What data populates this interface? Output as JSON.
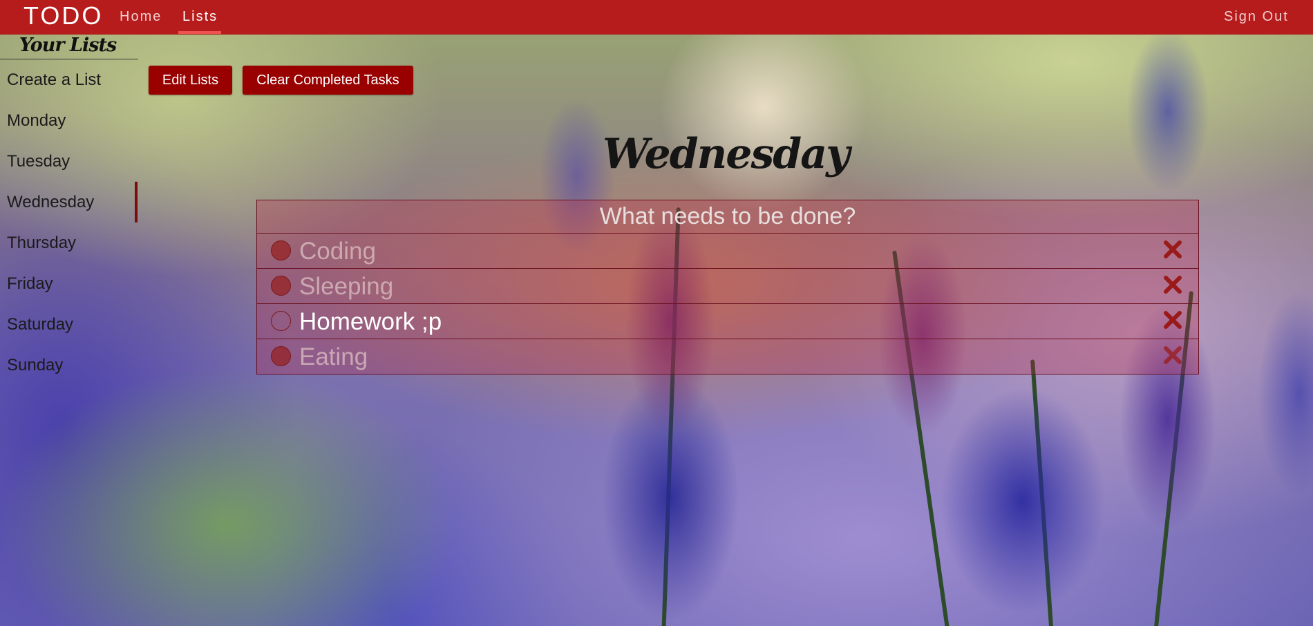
{
  "navbar": {
    "brand": "TODO",
    "links": [
      {
        "label": "Home"
      },
      {
        "label": "Lists"
      }
    ],
    "sign_out": "Sign Out",
    "color": "#b71c1c"
  },
  "sidebar": {
    "title": "Your Lists",
    "create_label": "Create a List",
    "items": [
      {
        "label": "Monday"
      },
      {
        "label": "Tuesday"
      },
      {
        "label": "Wednesday"
      },
      {
        "label": "Thursday"
      },
      {
        "label": "Friday"
      },
      {
        "label": "Saturday"
      },
      {
        "label": "Sunday"
      }
    ],
    "active": "Wednesday"
  },
  "toolbar": {
    "edit_label": "Edit Lists",
    "clear_label": "Clear Completed Tasks",
    "button_color": "#990000"
  },
  "list": {
    "title": "Wednesday",
    "placeholder": "What needs to be done?",
    "tasks": [
      {
        "text": "Coding",
        "completed": true
      },
      {
        "text": "Sleeping",
        "completed": true
      },
      {
        "text": "Homework ;p",
        "completed": false
      },
      {
        "text": "Eating",
        "completed": true
      }
    ],
    "delete_icon": "close-icon"
  }
}
